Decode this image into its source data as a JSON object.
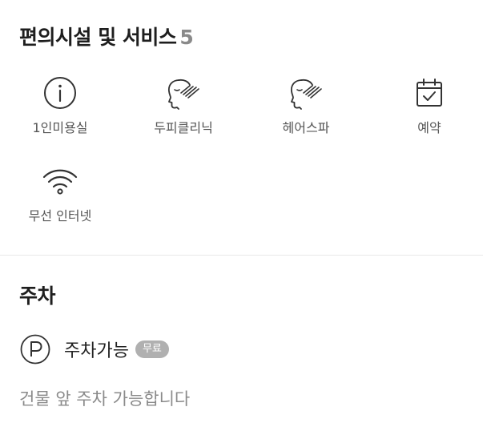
{
  "amenities": {
    "title": "편의시설 및 서비스",
    "count": "5",
    "items": [
      {
        "label": "1인미용실",
        "icon": "info-icon"
      },
      {
        "label": "두피클리닉",
        "icon": "scalp-care-icon"
      },
      {
        "label": "헤어스파",
        "icon": "hair-spa-icon"
      },
      {
        "label": "예약",
        "icon": "calendar-check-icon"
      },
      {
        "label": "무선 인터넷",
        "icon": "wifi-icon"
      }
    ]
  },
  "parking": {
    "title": "주차",
    "status": "주차가능",
    "badge": "무료",
    "note": "건물 앞 주차 가능합니다",
    "icon": "parking-icon"
  },
  "colors": {
    "title": "#1e1e1e",
    "count": "#8a8a8a",
    "label": "#555555",
    "icon_stroke": "#333333",
    "badge_bg": "#b0b0b0",
    "divider": "#e8e8e8"
  }
}
